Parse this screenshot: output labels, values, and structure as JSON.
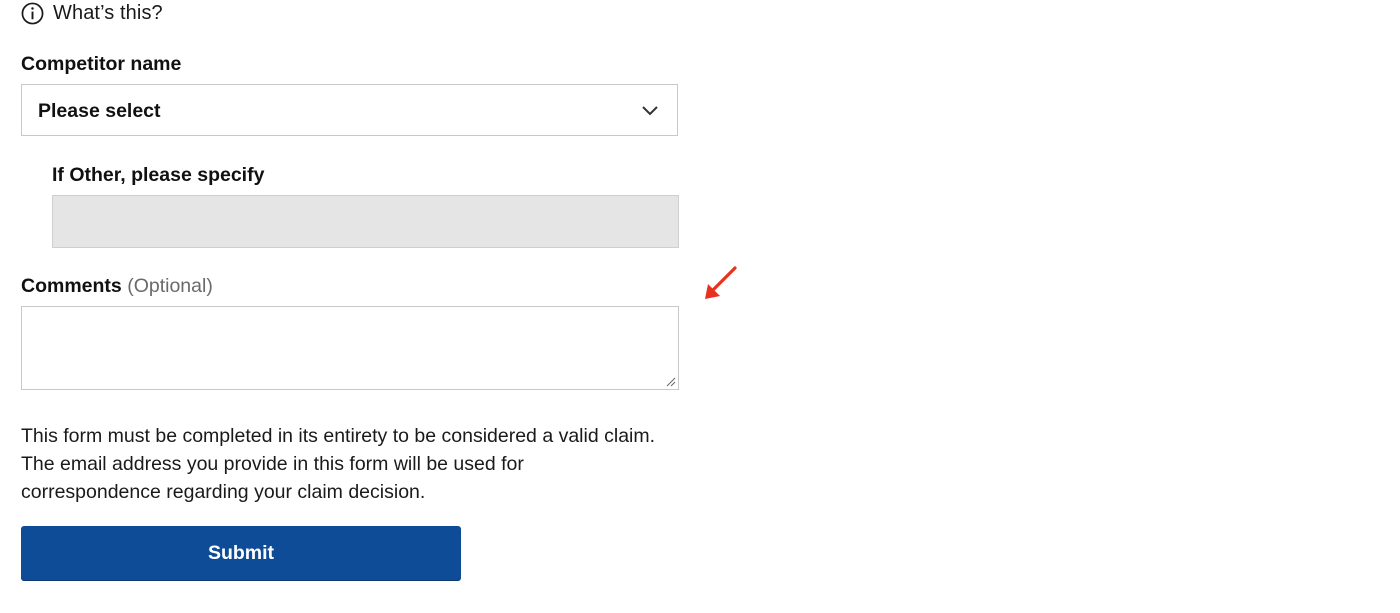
{
  "help": {
    "label": "What’s this?",
    "icon": "info-circle-icon"
  },
  "competitor": {
    "label": "Competitor name",
    "selected_value": "Please select",
    "chevron_icon": "chevron-down-icon"
  },
  "other": {
    "label": "If Other, please specify",
    "value": ""
  },
  "comments": {
    "label": "Comments",
    "optional_label": "(Optional)",
    "value": ""
  },
  "disclaimer": {
    "text": "This form must be completed in its entirety to be considered a valid claim. The email address you provide in this form will be used for correspondence regarding your claim decision."
  },
  "submit": {
    "label": "Submit"
  },
  "colors": {
    "button_bg": "#0f4c97",
    "disabled_field_bg": "#e5e5e5",
    "annotation_arrow": "#e8321e"
  }
}
